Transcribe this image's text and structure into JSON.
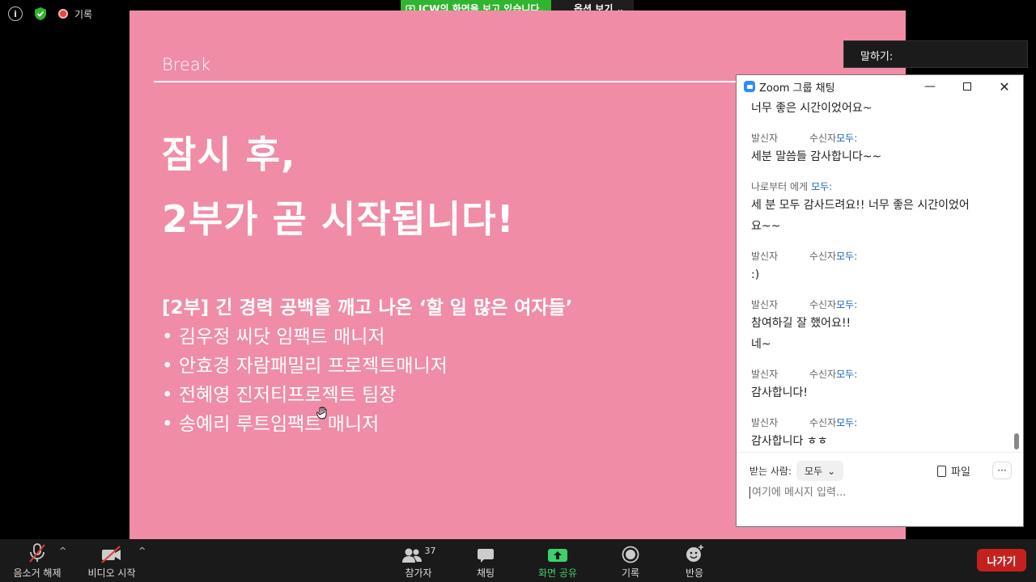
{
  "status": {
    "record_label": "기록"
  },
  "share_banner": {
    "text": "ICW의 화면을 보고 있습니다.",
    "options_label": "옵션 보기"
  },
  "slide": {
    "break_label": "Break",
    "headline_line1": "잠시 후,",
    "headline_line2": "2부가 곧 시작됩니다!",
    "program_title": "[2부] 긴 경력 공백을 깨고 나온 ‘할 일 많은 여자들’",
    "speakers": [
      "• 김우정 씨닷 임팩트 매니저",
      "• 안효경 자람패밀리 프로젝트매니저",
      "• 전혜영 진저티프로젝트 팀장",
      "• 송예리 루트임팩트 매니저"
    ]
  },
  "speaking": {
    "label": "말하기:"
  },
  "chat": {
    "title": "Zoom 그룹 채팅",
    "messages": [
      {
        "from": "",
        "to": "",
        "lines": [
          "너무 좋은 시간이었어요~"
        ]
      },
      {
        "from": "발신자",
        "to": "수신자",
        "everyone": "모두:",
        "lines": [
          "세분 말씀들 감사합니다~~"
        ]
      },
      {
        "from": "나로부터 에게",
        "to": "",
        "everyone": "모두:",
        "lines": [
          "세 분 모두 감사드려요!! 너무 좋은 시간이었어",
          "요~~"
        ]
      },
      {
        "from": "발신자",
        "to": "수신자",
        "everyone": "모두:",
        "lines": [
          ":)"
        ]
      },
      {
        "from": "발신자",
        "to": "수신자",
        "everyone": "모두:",
        "lines": [
          "참여하길 잘 했어요!!",
          "네~"
        ]
      },
      {
        "from": "발신자",
        "to": "수신자",
        "everyone": "모두:",
        "lines": [
          "감사합니다!"
        ]
      },
      {
        "from": "발신자",
        "to": "수신자",
        "everyone": "모두:",
        "lines": [
          "감사합니다 ㅎㅎ"
        ]
      }
    ],
    "to_label": "받는 사람:",
    "to_value": "모두",
    "file_label": "파일",
    "more_label": "···",
    "input_placeholder": "여기에 메시지 입력..."
  },
  "toolbar": {
    "unmute": "음소거 해제",
    "start_video": "비디오 시작",
    "participants": "참가자",
    "participant_count": "37",
    "chat": "채팅",
    "share_screen": "화면 공유",
    "record": "기록",
    "reactions": "반응",
    "leave": "나가기"
  },
  "colors": {
    "slide_bg": "#f08ca6",
    "share_green": "#2fb52f",
    "leave_red": "#c4211e",
    "link_blue": "#1a5fc4"
  }
}
